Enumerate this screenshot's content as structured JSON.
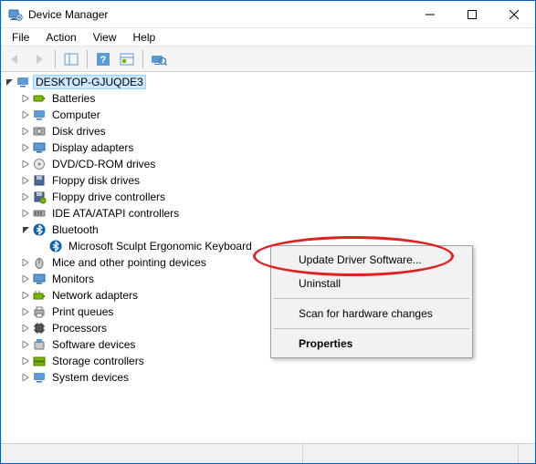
{
  "window": {
    "title": "Device Manager"
  },
  "menu": {
    "file": "File",
    "action": "Action",
    "view": "View",
    "help": "Help"
  },
  "tree": {
    "root": "DESKTOP-GJUQDE3",
    "categories": {
      "batteries": "Batteries",
      "computer": "Computer",
      "disk_drives": "Disk drives",
      "display_adapters": "Display adapters",
      "dvd_cdrom": "DVD/CD-ROM drives",
      "floppy_disk": "Floppy disk drives",
      "floppy_ctrl": "Floppy drive controllers",
      "ide_ata": "IDE ATA/ATAPI controllers",
      "bluetooth": "Bluetooth",
      "bt_device": "Microsoft Sculpt Ergonomic Keyboard",
      "mice": "Mice and other pointing devices",
      "monitors": "Monitors",
      "network": "Network adapters",
      "print_queues": "Print queues",
      "processors": "Processors",
      "software_devices": "Software devices",
      "storage_ctrl": "Storage controllers",
      "system_devices": "System devices"
    }
  },
  "context_menu": {
    "update": "Update Driver Software...",
    "uninstall": "Uninstall",
    "scan": "Scan for hardware changes",
    "properties": "Properties"
  }
}
